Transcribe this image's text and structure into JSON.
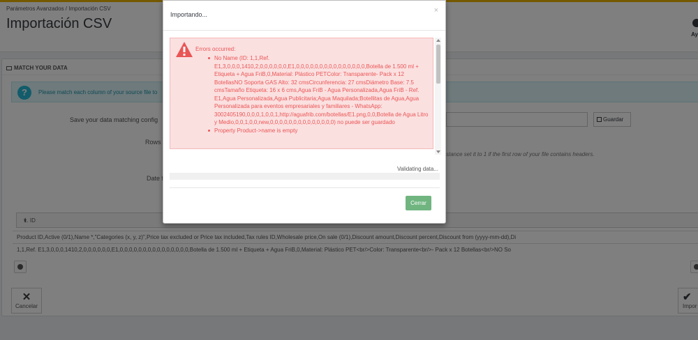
{
  "header": {
    "breadcrumb": "Parámetros Avanzados  /  Importación CSV",
    "title": "Importación CSV",
    "help_label": "Ay"
  },
  "panel": {
    "heading": "MATCH YOUR DATA",
    "info_text": "Please match each column of your source file to",
    "save_label": "Save your data matching config",
    "rows_label": "Rows t",
    "date_label": "Date f",
    "guardar_label": "Guardar",
    "hint_text": "stance set it to 1 if the first row of your file contains headers.",
    "column_select_value": "1. ID",
    "header_row": "Product ID,Active (0/1),Name *,\"Categories (x, y, z)\",Price tax excluded or Price tax included,Tax rules ID,Wholesale price,On sale (0/1),Discount amount,Discount percent,Discount from (yyyy-mm-dd),Di",
    "data_row": "1,1,Ref. E1,3,0,0,0,1410,2,0,0,0,0,0,0,E1,0,0,0,0,0,0,0,0,0,0,0,0,0,0,0,Botella de 1.500 ml + Etiqueta + Agua FriB,0,Material: Plástico PET<br/>Color: Transparente<br/>- Pack x 12 Botellas<br/>NO So",
    "cancel_label": "Cancelar",
    "import_label": "Impor"
  },
  "modal": {
    "title": "Importando...",
    "close_glyph": "×",
    "error_title": "Errors occurred:",
    "errors": [
      "No Name (ID: 1,1,Ref. E1,3,0,0,0,1410,2,0,0,0,0,0,0,E1,0,0,0,0,0,0,0,0,0,0,0,0,0,0,0,Botella de 1.500 ml + Etiqueta + Agua FriB,0,Material: Plástico PETColor: Transparente- Pack x 12 BotellasNO Soporta GAS Alto: 32 cmsCircunferencia: 27 cmsDiámetro Base: 7.5 cmsTamaño Etiqueta: 16 x 6 cms,Agua FriB - Agua Personalizada,Agua FriB - Ref. E1,Agua Personalizada,Agua Publicitaria;Agua Maquilada;Botellitas de Agua,Agua Personalizada para eventos empresariales y familiares - WhatsApp: 3002405190,0,0,0,1,0,0,1,http://aguafrib.com/botellas/E1.png,0,0,Botella de Agua Litro y Medio,0,0,1,0,0,new,0,0,0,0,0,0,0,0,0,0,0,0,0,0) no puede ser guardado",
      "Property Product->name is empty"
    ],
    "validating_text": "Validating data...",
    "progress_percent": 0,
    "cerrar_label": "Cerrar"
  },
  "colors": {
    "accent": "#25b9d7",
    "error_text": "#ea5555",
    "error_bg": "#fbe0e0",
    "success": "#70b580",
    "topline": "#e9b300"
  }
}
